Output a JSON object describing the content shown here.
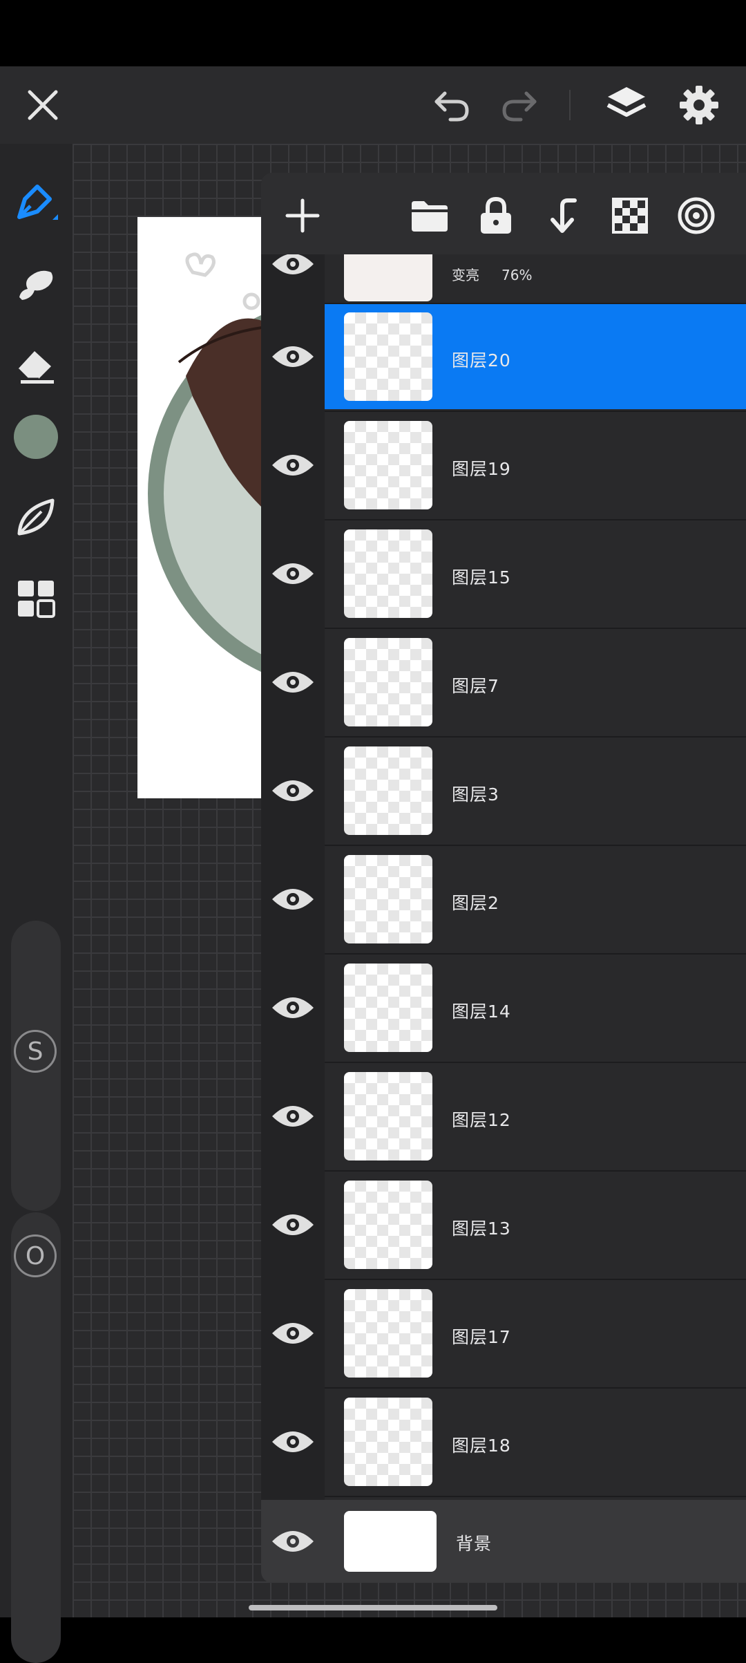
{
  "topbar": {
    "close_icon": "close-icon",
    "undo_icon": "undo-icon",
    "redo_icon": "redo-icon",
    "layers_icon": "layers-icon",
    "settings_icon": "gear-icon"
  },
  "toolbar": {
    "tools": [
      "pen-tool-icon",
      "smudge-icon",
      "eraser-icon",
      "color-swatch",
      "leaf-brush-icon",
      "grid-menu-icon"
    ],
    "current_color": "#7b8f80",
    "accent": "#1a8cff"
  },
  "sliders": {
    "size_label": "S",
    "opacity_label": "O"
  },
  "layers_panel": {
    "actions": [
      "add-layer-icon",
      "folder-icon",
      "lock-icon",
      "merge-down-icon",
      "checker-icon",
      "reference-icon"
    ],
    "partial_layer": {
      "blend_mode": "变亮",
      "opacity": "76%"
    },
    "layers": [
      {
        "name": "图层20",
        "selected": true
      },
      {
        "name": "图层19",
        "selected": false
      },
      {
        "name": "图层15",
        "selected": false
      },
      {
        "name": "图层7",
        "selected": false
      },
      {
        "name": "图层3",
        "selected": false
      },
      {
        "name": "图层2",
        "selected": false
      },
      {
        "name": "图层14",
        "selected": false
      },
      {
        "name": "图层12",
        "selected": false
      },
      {
        "name": "图层13",
        "selected": false
      },
      {
        "name": "图层17",
        "selected": false
      },
      {
        "name": "图层18",
        "selected": false
      }
    ],
    "background_label": "背景",
    "selection_color": "#0a7af3"
  }
}
